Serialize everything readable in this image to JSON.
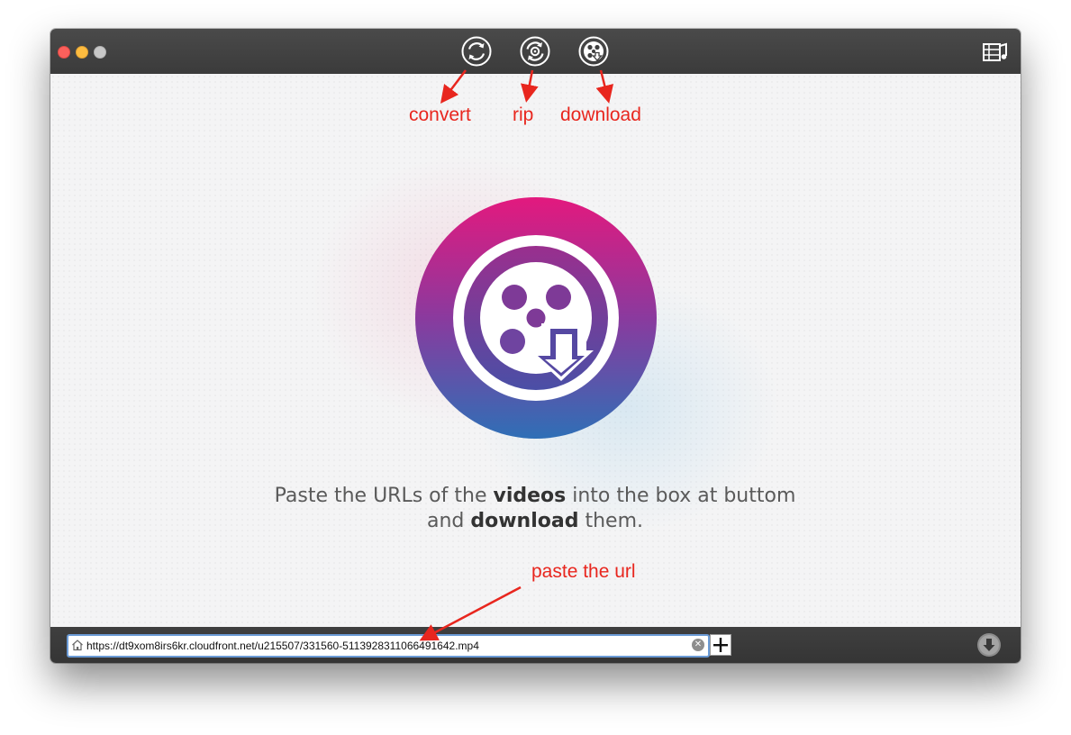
{
  "toolbar": {
    "convert_icon": "convert-circular-arrows-icon",
    "rip_icon": "rip-disc-arrows-icon",
    "download_icon": "download-film-reel-icon",
    "media_icon": "media-browser-icon"
  },
  "main": {
    "instruction_line1_pre": "Paste the URLs of the ",
    "instruction_line1_bold": "videos",
    "instruction_line1_post": " into the box at buttom",
    "instruction_line2_pre": "and ",
    "instruction_line2_bold": "download",
    "instruction_line2_post": " them."
  },
  "bottom": {
    "url_value": "https://dt9xom8irs6kr.cloudfront.net/u215507/331560-5113928311066491642.mp4",
    "clear_label": "✕",
    "add_label": "+"
  },
  "annotations": {
    "convert": "convert",
    "rip": "rip",
    "download": "download",
    "paste": "paste the url"
  },
  "colors": {
    "annotation": "#e8261e",
    "titlebar": "#3e3e3e",
    "logo_top": "#e3197e",
    "logo_bottom": "#2f6fb6"
  }
}
